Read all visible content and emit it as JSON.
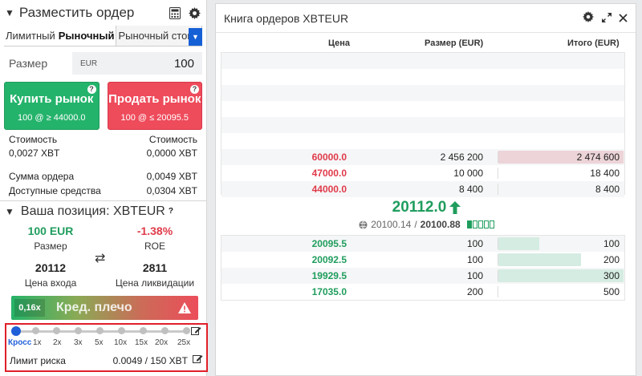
{
  "order": {
    "title": "Разместить ордер",
    "tabs": [
      "Лимитный",
      "Рыночный",
      "Рыночный стоп"
    ],
    "active_tab": 1,
    "size_label": "Размер",
    "currency": "EUR",
    "size_value": "100",
    "buy": {
      "label": "Купить рынок",
      "sub": "100 @ ≥ 44000.0"
    },
    "sell": {
      "label": "Продать рынок",
      "sub": "100 @ ≤ 20095.5"
    },
    "cost_label": "Стоимость",
    "cost_buy": "0,0027 XBT",
    "cost_sell": "0,0000 XBT",
    "order_sum_label": "Сумма ордера",
    "order_sum": "0,0049 XBT",
    "available_label": "Доступные средства",
    "available": "0,0304 XBT"
  },
  "position": {
    "title": "Ваша позиция: XBTEUR",
    "size_value": "100 EUR",
    "size_label": "Размер",
    "roe_value": "-1.38%",
    "roe_label": "ROE",
    "entry_value": "20112",
    "entry_label": "Цена входа",
    "liq_value": "2811",
    "liq_label": "Цена ликвидации",
    "leverage_value": "0,16x",
    "leverage_label": "Кред. плечо",
    "ticks": [
      "Кросс",
      "1x",
      "2x",
      "3x",
      "5x",
      "10x",
      "15x",
      "20x",
      "25x"
    ],
    "risk_label": "Лимит риска",
    "risk_value": "0.0049 / 150 XBT"
  },
  "orderbook": {
    "title": "Книга ордеров XBTEUR",
    "columns": [
      "Цена",
      "Размер (EUR)",
      "Итого (EUR)"
    ],
    "asks": [
      {
        "price": "60000.0",
        "size": "2 456 200",
        "total": "2 474 600",
        "depth": 1.0
      },
      {
        "price": "47000.0",
        "size": "10 000",
        "total": "18 400",
        "depth": 0.0
      },
      {
        "price": "44000.0",
        "size": "8 400",
        "total": "8 400",
        "depth": 0.0
      }
    ],
    "last_price": "20112.0",
    "mark_index": "20100.14",
    "fair_price": "20100.88",
    "bids": [
      {
        "price": "20095.5",
        "size": "100",
        "total": "100",
        "depth": 0.33
      },
      {
        "price": "20092.5",
        "size": "100",
        "total": "200",
        "depth": 0.66
      },
      {
        "price": "19929.5",
        "size": "100",
        "total": "300",
        "depth": 1.0
      },
      {
        "price": "17035.0",
        "size": "200",
        "total": "500",
        "depth": 0.0
      }
    ],
    "colors": {
      "ask": "#e03a4a",
      "bid": "#1f9d5d",
      "ask_bar": "#ecd4d8",
      "bid_bar": "#d5ece2"
    }
  }
}
